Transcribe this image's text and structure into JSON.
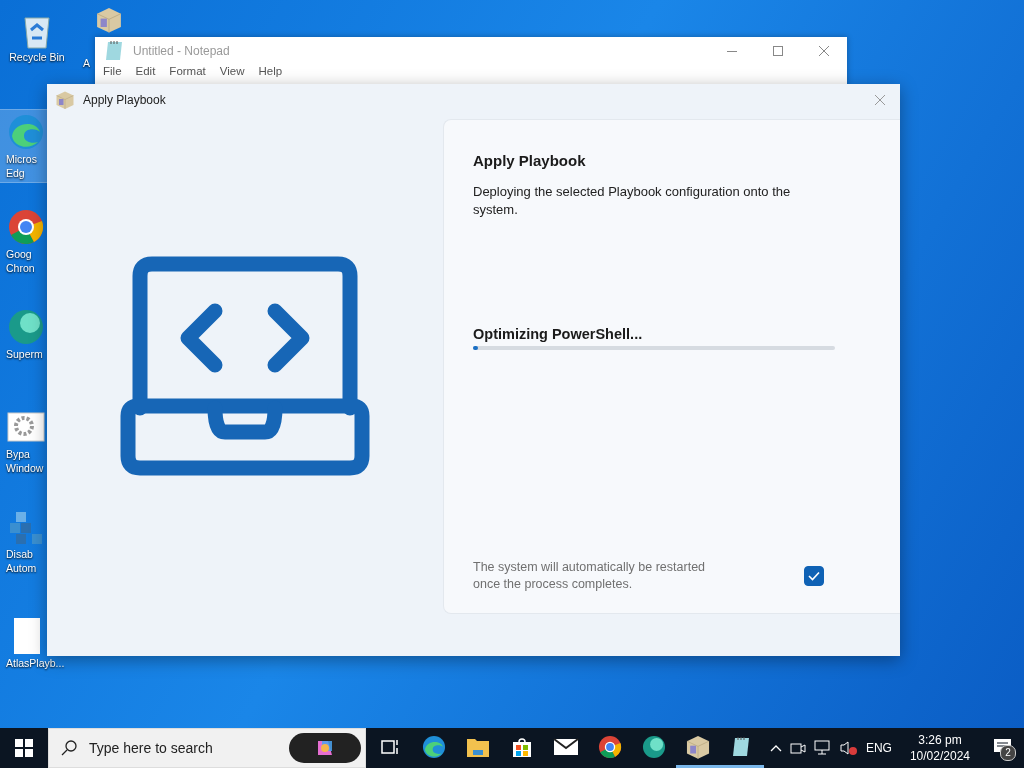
{
  "desktop_icons": [
    {
      "kind": "recycle",
      "lines": [
        "Recycle Bin"
      ],
      "selected": false
    },
    {
      "kind": "box",
      "lines": [
        "A"
      ],
      "selected": false
    },
    {
      "kind": "edge",
      "lines": [
        "Micros",
        "Edg"
      ],
      "selected": true
    },
    {
      "kind": "chrome",
      "lines": [
        "Goog",
        "Chron"
      ],
      "selected": false
    },
    {
      "kind": "orb",
      "lines": [
        "Superm"
      ],
      "selected": false
    },
    {
      "kind": "gears",
      "lines": [
        "Bypa",
        "Window"
      ],
      "selected": false
    },
    {
      "kind": "cubes",
      "lines": [
        "Disab",
        "Autom"
      ],
      "selected": false
    },
    {
      "kind": "file",
      "lines": [
        "AtlasPlayb..."
      ],
      "selected": false
    }
  ],
  "notepad": {
    "title": "Untitled - Notepad",
    "menu": [
      "File",
      "Edit",
      "Format",
      "View",
      "Help"
    ]
  },
  "dialog": {
    "title": "Apply Playbook",
    "heading": "Apply Playbook",
    "description": "Deploying the selected Playbook configuration onto the system.",
    "status": "Optimizing PowerShell...",
    "progress": {
      "level": 0.015
    },
    "restart_note": "The system will automatically be restarted once the process completes.",
    "restart_checked": true
  },
  "taskbar": {
    "search": {
      "placeholder": "Type here to search"
    },
    "apps": [
      {
        "kind": "taskview",
        "active": false
      },
      {
        "kind": "edge",
        "active": false
      },
      {
        "kind": "folder",
        "active": false
      },
      {
        "kind": "store",
        "active": false
      },
      {
        "kind": "mail",
        "active": false
      },
      {
        "kind": "chrome",
        "active": false
      },
      {
        "kind": "orb",
        "active": false
      },
      {
        "kind": "box",
        "active": true
      },
      {
        "kind": "notepad",
        "active": true
      }
    ],
    "language": "ENG",
    "time": "3:26 pm",
    "date": "10/02/2024",
    "notifications": "2"
  }
}
